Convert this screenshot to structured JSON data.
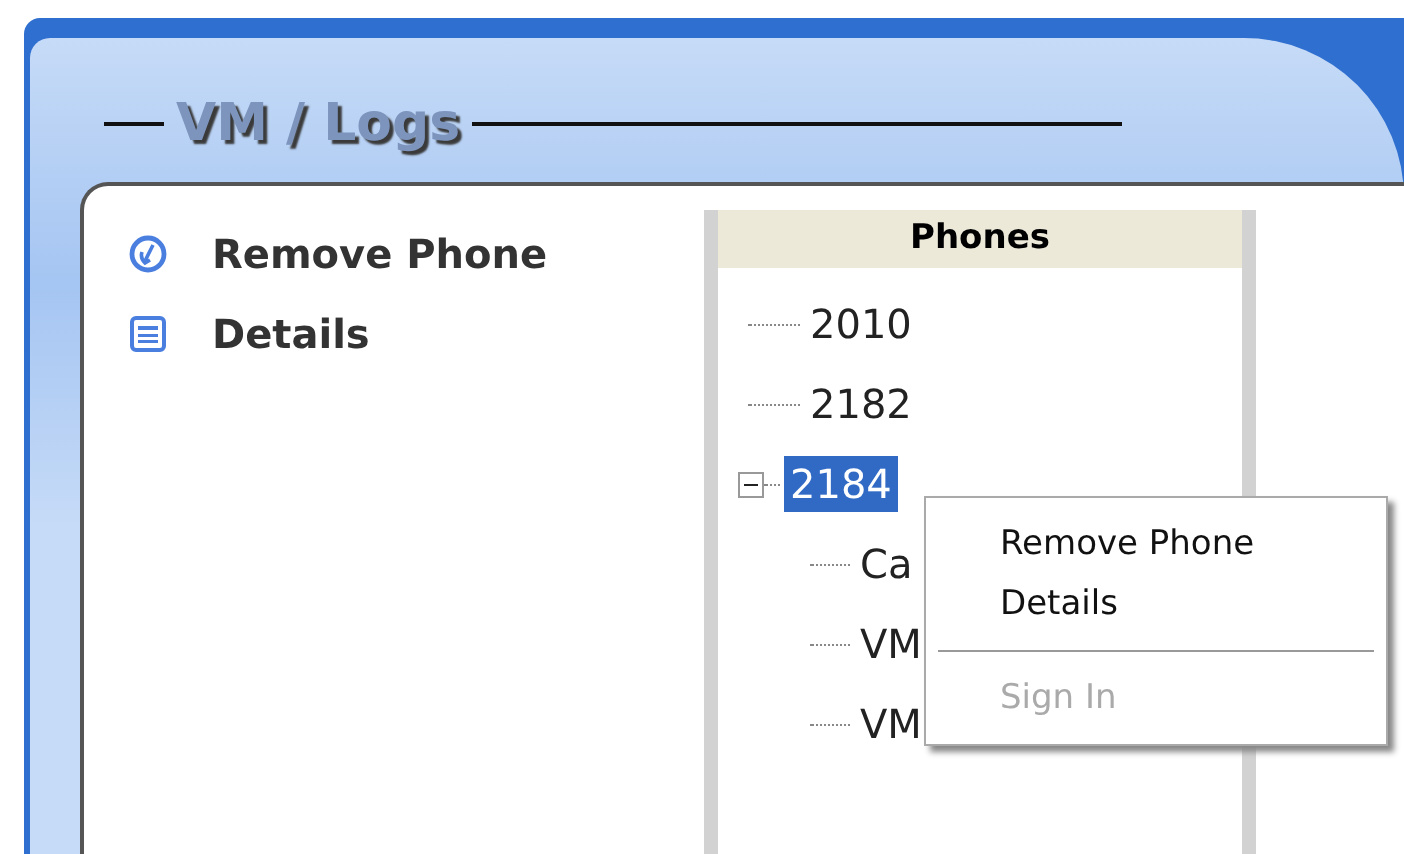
{
  "panel": {
    "title": "VM / Logs"
  },
  "actions": [
    {
      "kind": "remove",
      "label": "Remove Phone"
    },
    {
      "kind": "details",
      "label": "Details"
    }
  ],
  "tree": {
    "header": "Phones",
    "items": [
      {
        "label": "2010",
        "selected": false
      },
      {
        "label": "2182",
        "selected": false
      },
      {
        "label": "2184",
        "selected": true,
        "expanded": true,
        "children": [
          {
            "label": "Ca"
          },
          {
            "label": "VM"
          },
          {
            "label": "VM"
          }
        ]
      }
    ]
  },
  "context_menu": {
    "items": [
      {
        "label": "Remove Phone",
        "disabled": false
      },
      {
        "label": "Details",
        "disabled": false
      },
      {
        "label": "Sign In",
        "disabled": true
      }
    ]
  }
}
